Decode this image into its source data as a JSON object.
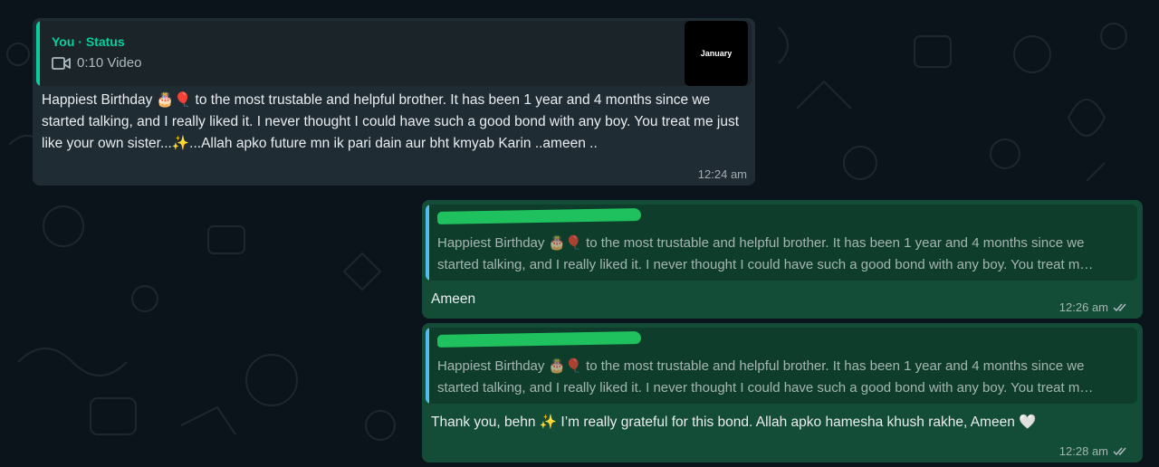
{
  "incoming": {
    "status_author": "You · Status",
    "status_media": "0:10 Video",
    "status_thumb_text": "January",
    "text": "Happiest Birthday 🎂🎈 to the most trustable and helpful brother. It has been 1 year and 4 months since we started talking, and I really liked it. I never thought I could have such a good bond with any boy. You treat me just like your own sister...✨...Allah apko future mn ik pari dain aur bht kmyab Karin ..ameen ..",
    "time": "12:24 am",
    "icon": "video-icon"
  },
  "outgoing": [
    {
      "quote_line1": "Happiest Birthday 🎂🎈 to the most trustable and helpful brother. It has been 1 year and 4 months since we",
      "quote_line2": "started talking, and I really liked it. I never thought I could have such a good bond with any boy. You treat m…",
      "text": "Ameen",
      "time": "12:26 am",
      "status_icon": "double-check-icon"
    },
    {
      "quote_line1": "Happiest Birthday 🎂🎈 to the most trustable and helpful brother. It has been 1 year and 4 months since we",
      "quote_line2": "started talking, and I really liked it. I never thought I could have such a good bond with any boy. You treat m…",
      "text": "Thank you, behn  ✨ I’m really grateful for this bond. Allah apko hamesha khush rakhe, Ameen 🤍",
      "time": "12:28 am",
      "status_icon": "double-check-icon"
    }
  ],
  "colors": {
    "incoming_bubble": "#202c33",
    "outgoing_bubble": "#144d37",
    "status_accent": "#06cf9c",
    "reply_accent": "#53bdeb",
    "redaction": "#1ec15e"
  }
}
